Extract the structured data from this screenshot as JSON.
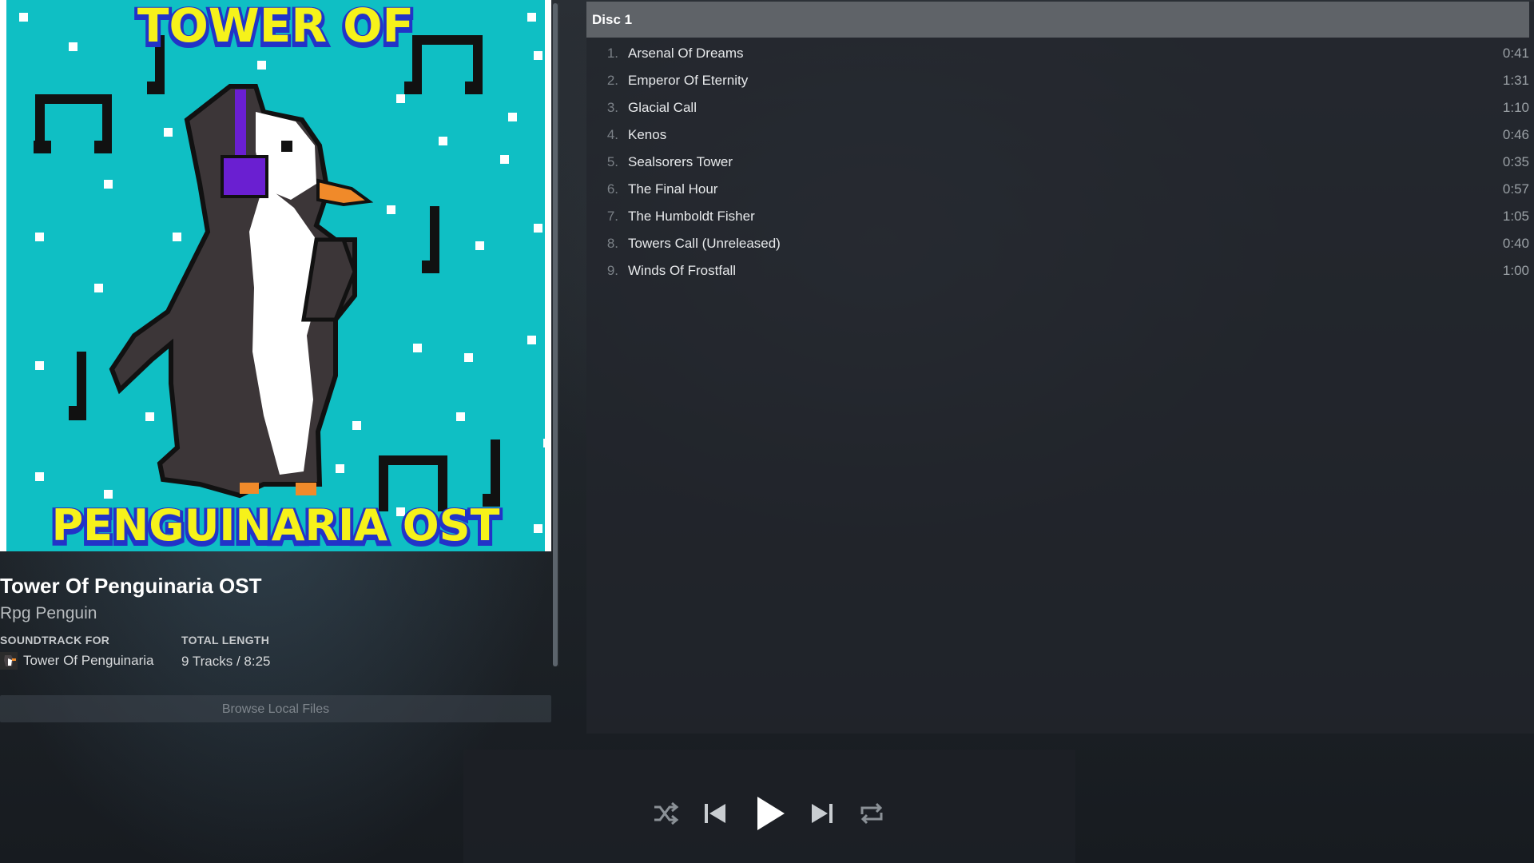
{
  "colors": {
    "art_background": "#0fbfc4",
    "art_title_yellow": "#f6f21a",
    "art_title_blue": "#2233c8",
    "headphones_purple": "#6a1fd1",
    "beak_orange": "#f08a2a",
    "header_gray": "#5f6368"
  },
  "album": {
    "art_title_top": "TOWER OF",
    "art_title_bottom": "PENGUINARIA OST",
    "title": "Tower Of Penguinaria OST",
    "artist": "Rpg Penguin",
    "soundtrack_for_label": "SOUNDTRACK FOR",
    "game_name": "Tower Of Penguinaria",
    "total_length_label": "TOTAL LENGTH",
    "total_length": "9 Tracks / 8:25",
    "browse_button": "Browse Local Files"
  },
  "tracklist": {
    "disc_label": "Disc 1",
    "tracks": [
      {
        "num": "1.",
        "title": "Arsenal Of Dreams",
        "duration": "0:41"
      },
      {
        "num": "2.",
        "title": "Emperor Of Eternity",
        "duration": "1:31"
      },
      {
        "num": "3.",
        "title": "Glacial Call",
        "duration": "1:10"
      },
      {
        "num": "4.",
        "title": "Kenos",
        "duration": "0:46"
      },
      {
        "num": "5.",
        "title": "Sealsorers Tower",
        "duration": "0:35"
      },
      {
        "num": "6.",
        "title": "The Final Hour",
        "duration": "0:57"
      },
      {
        "num": "7.",
        "title": "The Humboldt Fisher",
        "duration": "1:05"
      },
      {
        "num": "8.",
        "title": "Towers Call (Unreleased)",
        "duration": "0:40"
      },
      {
        "num": "9.",
        "title": "Winds Of Frostfall",
        "duration": "1:00"
      }
    ]
  },
  "player": {
    "controls": [
      "shuffle-icon",
      "previous-icon",
      "play-icon",
      "next-icon",
      "repeat-icon"
    ]
  }
}
